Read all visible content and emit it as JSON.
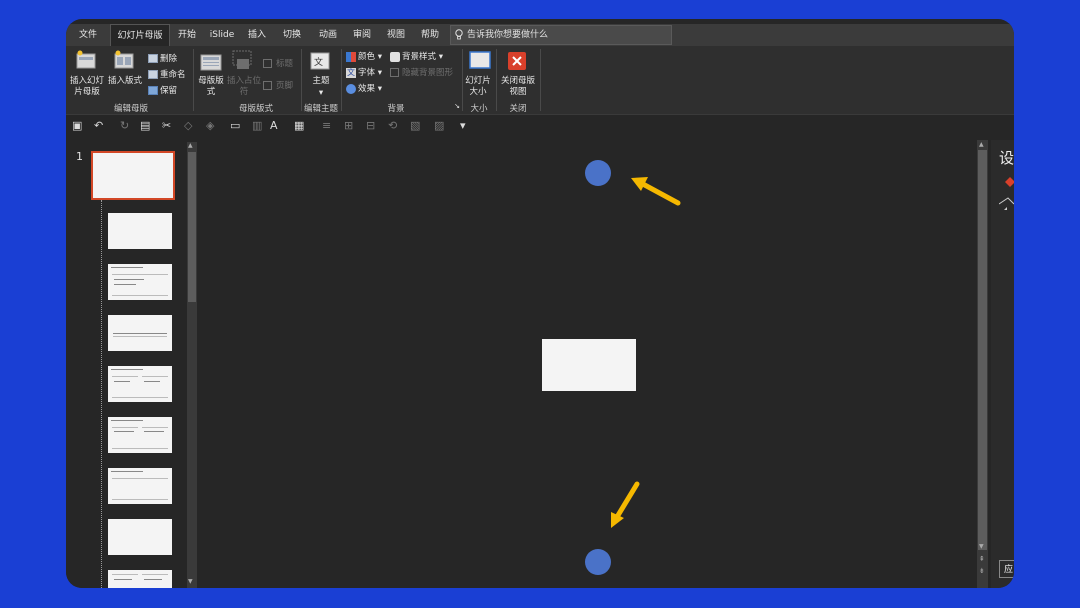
{
  "tabs": [
    {
      "label": "文件"
    },
    {
      "label": "幻灯片母版"
    },
    {
      "label": "开始"
    },
    {
      "label": "iSlide"
    },
    {
      "label": "插入"
    },
    {
      "label": "切换"
    },
    {
      "label": "动画"
    },
    {
      "label": "审阅"
    },
    {
      "label": "视图"
    },
    {
      "label": "帮助"
    }
  ],
  "search": {
    "placeholder": "告诉我你想要做什么"
  },
  "ribbon": {
    "edit_master": {
      "insert_slide_master": "插入幻灯片母版",
      "insert_layout": "插入版式",
      "delete": "删除",
      "rename": "重命名",
      "preserve": "保留",
      "group_label": "编辑母版"
    },
    "master_layout": {
      "master_layout_btn": "母版版式",
      "insert_placeholder": "插入占位符",
      "title": "标题",
      "footer": "页脚",
      "group_label": "母版版式"
    },
    "edit_theme": {
      "theme": "主题",
      "group_label": "编辑主题"
    },
    "background": {
      "colors": "颜色",
      "fonts": "字体",
      "effects": "效果",
      "bg_styles": "背景样式",
      "hide_bg": "隐藏背景图形",
      "group_label": "背景"
    },
    "size": {
      "slide_size": "幻灯片大小",
      "group_label": "大小"
    },
    "close": {
      "close_master": "关闭母版视图",
      "group_label": "关闭"
    }
  },
  "thumbnail_panel": {
    "first_number": "1"
  },
  "right_pane": {
    "title_char": "设",
    "apply_char": "应"
  },
  "colors": {
    "accent_circle": "#4a72c8",
    "arrow": "#f5b800",
    "selection": "#d24726",
    "background": "#1a3fd4"
  }
}
